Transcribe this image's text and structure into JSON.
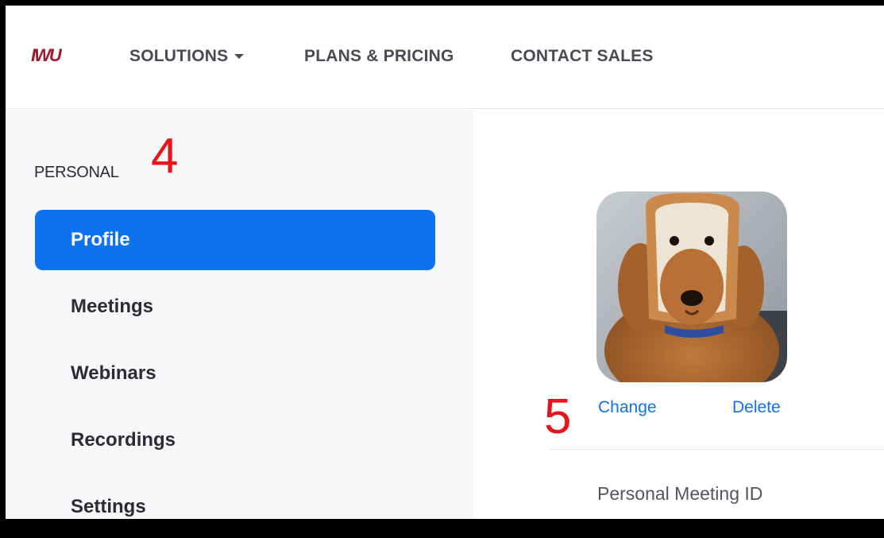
{
  "nav": {
    "logo_text": "IWU",
    "items": [
      {
        "label": "SOLUTIONS",
        "has_dropdown": true
      },
      {
        "label": "PLANS & PRICING"
      },
      {
        "label": "CONTACT SALES"
      }
    ]
  },
  "sidebar": {
    "section_label": "PERSONAL",
    "items": [
      {
        "label": "Profile",
        "active": true
      },
      {
        "label": "Meetings"
      },
      {
        "label": "Webinars"
      },
      {
        "label": "Recordings"
      },
      {
        "label": "Settings"
      }
    ]
  },
  "profile": {
    "change_label": "Change",
    "delete_label": "Delete",
    "personal_meeting_id_label": "Personal Meeting ID"
  },
  "annotations": [
    "4",
    "5"
  ],
  "colors": {
    "accent": "#0e72ed",
    "annotation": "#e8141b",
    "logo": "#9b1b30",
    "sidebar_bg": "#f6f7f9"
  }
}
